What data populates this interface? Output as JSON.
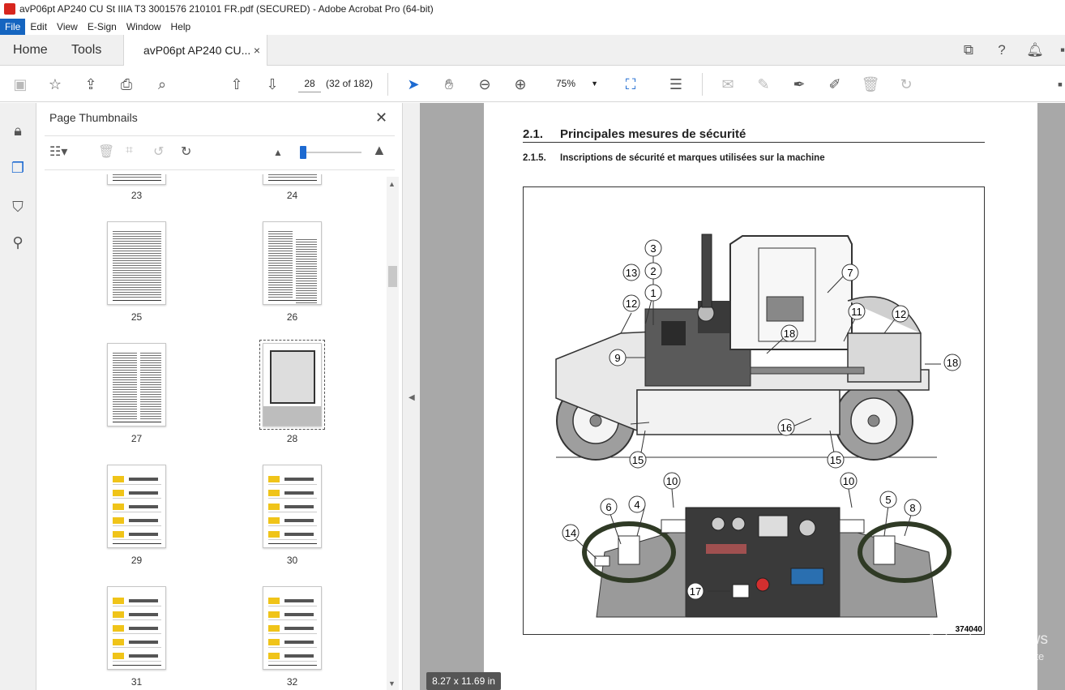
{
  "window": {
    "title": "avP06pt AP240 CU St IIIA T3 3001576 210101 FR.pdf (SECURED) - Adobe Acrobat Pro (64-bit)"
  },
  "menu": {
    "items": [
      "File",
      "Edit",
      "View",
      "E-Sign",
      "Window",
      "Help"
    ],
    "active": "File"
  },
  "tabs": {
    "home": "Home",
    "tools": "Tools",
    "document": "avP06pt AP240 CU...",
    "close": "×"
  },
  "toolbar": {
    "page_number": "28",
    "page_count": "(32 of 182)",
    "zoom": "75%"
  },
  "thumbnails_panel": {
    "title": "Page Thumbnails",
    "close": "✕",
    "pages": [
      {
        "label": "23",
        "kind": "text"
      },
      {
        "label": "24",
        "kind": "text"
      },
      {
        "label": "25",
        "kind": "text"
      },
      {
        "label": "26",
        "kind": "text"
      },
      {
        "label": "27",
        "kind": "text"
      },
      {
        "label": "28",
        "kind": "figure",
        "selected": true
      },
      {
        "label": "29",
        "kind": "rows"
      },
      {
        "label": "30",
        "kind": "rows"
      },
      {
        "label": "31",
        "kind": "rows"
      },
      {
        "label": "32",
        "kind": "rows"
      }
    ]
  },
  "document": {
    "section_number": "2.1.",
    "section_title": "Principales mesures de sécurité",
    "subsection_number": "2.1.5.",
    "subsection_title": "Inscriptions de sécurité et marques utilisées sur la machine",
    "figure_id": "374040",
    "callouts": [
      "1",
      "2",
      "3",
      "4",
      "5",
      "6",
      "7",
      "8",
      "9",
      "10",
      "10",
      "11",
      "12",
      "12",
      "13",
      "14",
      "15",
      "15",
      "16",
      "17",
      "18",
      "18"
    ]
  },
  "status": {
    "page_size": "8.27 x 11.69 in"
  },
  "watermark": {
    "line1": "Activate Windows",
    "line2": "Go to Settings to activate"
  }
}
